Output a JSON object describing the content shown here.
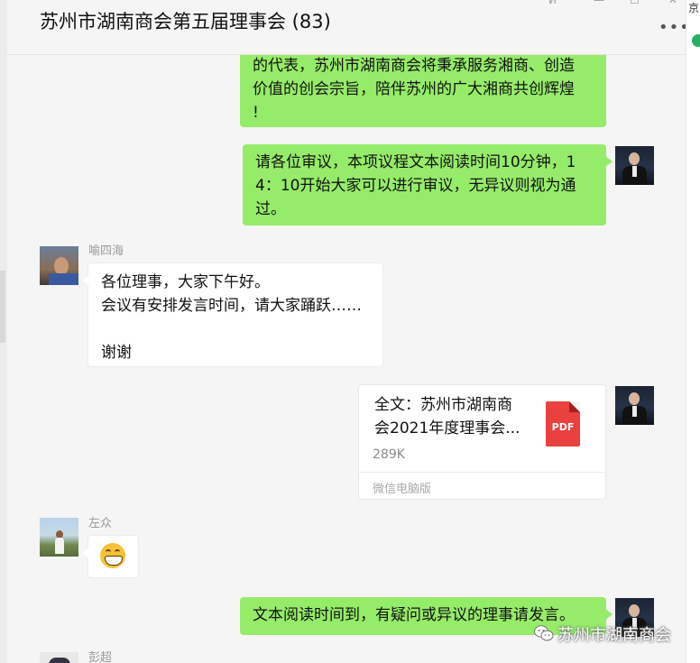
{
  "window": {
    "title": "苏州市湖南商会第五届理事会 (83)",
    "controls": [
      "ⵍ",
      "—",
      "☐",
      "✕"
    ],
    "more": "•••",
    "right_strip_text": "京"
  },
  "messages": {
    "m1": {
      "lines": [
        "的代表，苏州市湖南商会将秉承服务湘商、创造",
        "价值的创会宗旨，陪伴苏州的广大湘商共创辉煌",
        "!"
      ]
    },
    "m2": {
      "lines": [
        "请各位审议，本项议程文本阅读时间10分钟，1",
        "4：10开始大家可以进行审议，无异议则视为通",
        "过。"
      ]
    },
    "m3": {
      "sender": "喻四海",
      "lines": [
        "各位理事，大家下午好。",
        "会议有安排发言时间，请大家踊跃……",
        "",
        "谢谢"
      ]
    },
    "m4": {
      "file_name_lines": [
        "全文：苏州市湖南商",
        "会2021年度理事会..."
      ],
      "file_size": "289K",
      "source": "微信电脑版",
      "icon_label": "PDF",
      "icon": "pdf-file-icon"
    },
    "m5": {
      "sender": "左众",
      "emoji": "grinning-face-icon"
    },
    "m6": {
      "text": "文本阅读时间到，有疑问或异议的理事请发言。"
    },
    "m7": {
      "sender": "彭超"
    }
  },
  "watermark": {
    "text": "苏州市湖南商会"
  },
  "colors": {
    "self_bubble": "#95ec69",
    "other_bubble": "#ffffff",
    "background": "#f5f5f5",
    "pdf_red": "#e8413e"
  }
}
